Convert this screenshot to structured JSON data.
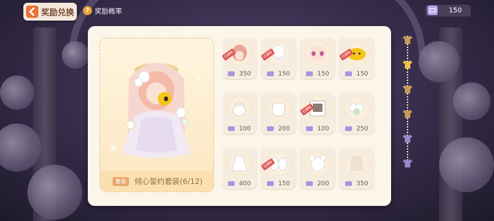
{
  "header": {
    "title": "奖励兑换",
    "probability_label": "奖励概率"
  },
  "currency": {
    "icon": "ticket-icon",
    "value": "150"
  },
  "featured": {
    "tag": "套装",
    "name": "倾心誓约套装(6/12)",
    "collected": 6,
    "total": 12
  },
  "items": [
    {
      "icon": "hair-icon",
      "cost": "350",
      "owned": true
    },
    {
      "icon": "headdress-icon",
      "cost": "150",
      "owned": true
    },
    {
      "icon": "face-icon",
      "cost": "150",
      "owned": false
    },
    {
      "icon": "pudding-icon",
      "cost": "150",
      "owned": true
    },
    {
      "icon": "bag-icon",
      "cost": "100",
      "owned": false
    },
    {
      "icon": "backpack-icon",
      "cost": "200",
      "owned": false
    },
    {
      "icon": "photo-frame-icon",
      "cost": "100",
      "owned": true
    },
    {
      "icon": "bouquet-icon",
      "cost": "250",
      "owned": false
    },
    {
      "icon": "dress-icon",
      "cost": "400",
      "owned": false
    },
    {
      "icon": "gloves-icon",
      "cost": "150",
      "owned": true
    },
    {
      "icon": "bear-icon",
      "cost": "200",
      "owned": false
    },
    {
      "icon": "outfit-icon",
      "cost": "350",
      "owned": false
    }
  ],
  "owned_badge": "已拥有",
  "rail": [
    {
      "icon": "shirt-icon",
      "active": false
    },
    {
      "icon": "shirt-icon",
      "active": true
    },
    {
      "icon": "shirt-icon",
      "active": false
    },
    {
      "icon": "shirt-icon",
      "active": false
    },
    {
      "icon": "shirt-icon",
      "active": false
    },
    {
      "icon": "shirt-icon",
      "active": false
    }
  ],
  "colors": {
    "accent": "#e8733a",
    "panel": "#fbf5ea",
    "owned_badge": "#e05252",
    "ticket": "#a895e0",
    "rail_active": "#f2c04e",
    "rail_gold": "#c99a5a",
    "rail_purple": "#9a86c8"
  }
}
